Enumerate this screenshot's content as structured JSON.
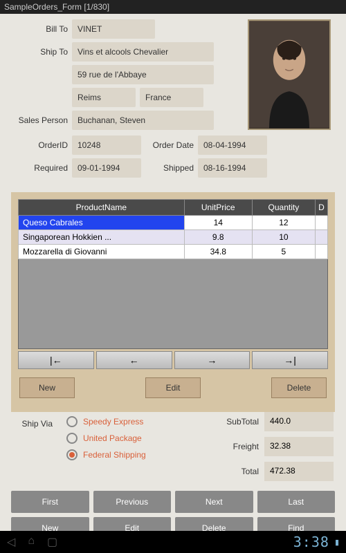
{
  "titlebar": "SampleOrders_Form [1/830]",
  "labels": {
    "billTo": "Bill To",
    "shipTo": "Ship To",
    "salesPerson": "Sales Person",
    "orderId": "OrderID",
    "orderDate": "Order Date",
    "required": "Required",
    "shipped": "Shipped",
    "shipVia": "Ship Via",
    "subTotal": "SubTotal",
    "freight": "Freight",
    "total": "Total"
  },
  "fields": {
    "billTo": "VINET",
    "shipToName": "Vins et alcools Chevalier",
    "shipToAddr": "59 rue de l'Abbaye",
    "shipToCity": "Reims",
    "shipToCountry": "France",
    "salesPerson": "Buchanan, Steven",
    "orderId": "10248",
    "orderDate": "08-04-1994",
    "required": "09-01-1994",
    "shipped": "08-16-1994"
  },
  "grid": {
    "headers": [
      "ProductName",
      "UnitPrice",
      "Quantity",
      "D"
    ],
    "rows": [
      {
        "name": "Queso Cabrales",
        "price": "14",
        "qty": "12",
        "sel": true
      },
      {
        "name": "Singaporean Hokkien ...",
        "price": "9.8",
        "qty": "10",
        "alt": true
      },
      {
        "name": "Mozzarella di Giovanni",
        "price": "34.8",
        "qty": "5"
      }
    ]
  },
  "gridButtons": {
    "new": "New",
    "edit": "Edit",
    "delete": "Delete"
  },
  "shipVia": {
    "options": [
      {
        "label": "Speedy Express",
        "checked": false
      },
      {
        "label": "United Package",
        "checked": false
      },
      {
        "label": "Federal Shipping",
        "checked": true
      }
    ]
  },
  "totals": {
    "subTotal": "440.0",
    "freight": "32.38",
    "total": "472.38"
  },
  "navButtons": {
    "first": "First",
    "previous": "Previous",
    "next": "Next",
    "last": "Last",
    "new": "New",
    "edit": "Edit",
    "delete": "Delete",
    "find": "Find"
  },
  "system": {
    "clock": "3:38"
  },
  "icons": {
    "navFirst": "|←",
    "navPrev": "←",
    "navNext": "→",
    "navLast": "→|"
  }
}
